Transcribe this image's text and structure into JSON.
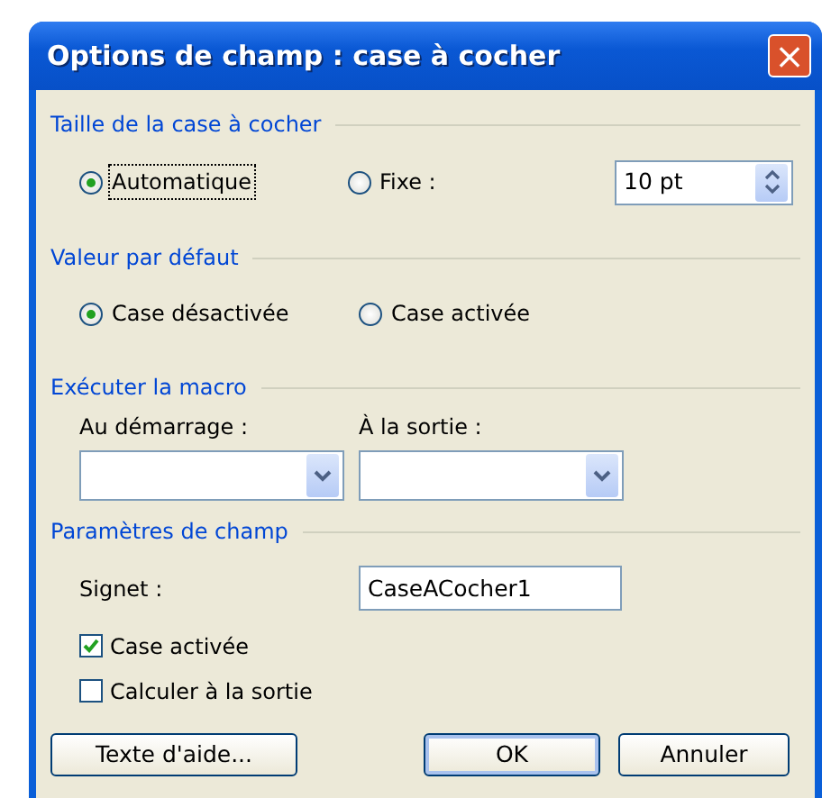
{
  "window": {
    "title": "Options de champ : case à cocher",
    "close": "×"
  },
  "size_group": {
    "heading": "Taille de la case à cocher",
    "options": [
      {
        "label": "Automatique",
        "selected": true,
        "focused": true
      },
      {
        "label": "Fixe :",
        "selected": false,
        "focused": false
      }
    ],
    "size_value": "10 pt"
  },
  "default_group": {
    "heading": "Valeur par défaut",
    "options": [
      {
        "label": "Case désactivée",
        "selected": true
      },
      {
        "label": "Case activée",
        "selected": false
      }
    ]
  },
  "macro_group": {
    "heading": "Exécuter la macro",
    "fields": [
      {
        "label": "Au démarrage :"
      },
      {
        "label": "À la sortie :"
      }
    ]
  },
  "field_group": {
    "heading": "Paramètres de champ",
    "bookmark_label": "Signet :",
    "bookmark_value": "CaseACocher1",
    "checkboxes": [
      {
        "label": "Case activée",
        "checked": true
      },
      {
        "label": "Calculer à la sortie",
        "checked": false
      }
    ]
  },
  "buttons": [
    {
      "label": "Texte d'aide...",
      "default": false
    },
    {
      "label": "OK",
      "default": true
    },
    {
      "label": "Annuler",
      "default": false
    }
  ]
}
